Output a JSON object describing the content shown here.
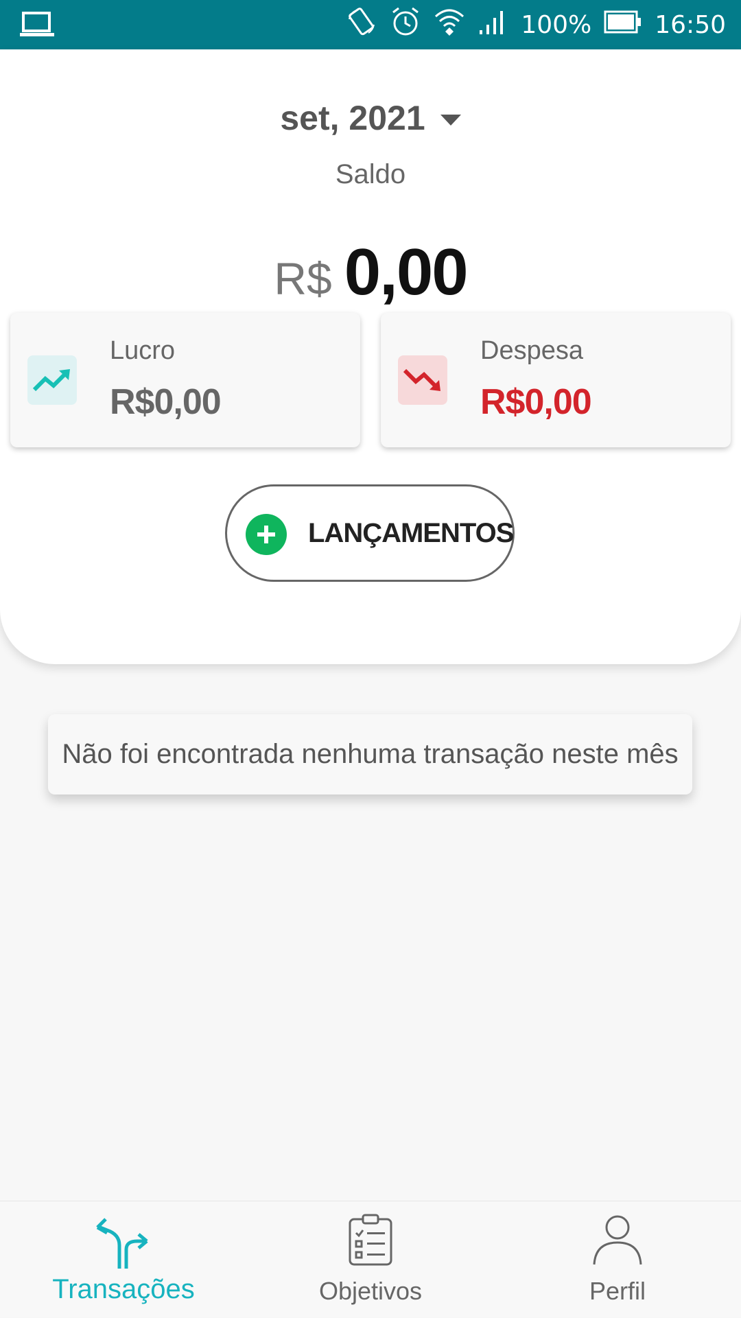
{
  "status_bar": {
    "battery": "100%",
    "time": "16:50",
    "icons": [
      "laptop-icon",
      "rotate-icon",
      "alarm-icon",
      "wifi-icon",
      "signal-icon",
      "battery-icon"
    ]
  },
  "header": {
    "month": "set, 2021",
    "balance_label": "Saldo",
    "currency": "R$",
    "balance_value": "0,00"
  },
  "summary": {
    "profit": {
      "label": "Lucro",
      "amount": "R$0,00",
      "icon": "trending-up-icon",
      "color": "#17c0b5"
    },
    "expense": {
      "label": "Despesa",
      "amount": "R$0,00",
      "icon": "trending-down-icon",
      "color": "#d3242b"
    }
  },
  "actions": {
    "lancamentos_label": "LANÇAMENTOS"
  },
  "transactions": {
    "empty_message": "Não foi encontrada nenhuma transação neste mês"
  },
  "bottom_nav": {
    "items": [
      {
        "label": "Transações",
        "icon": "transactions-icon",
        "active": true
      },
      {
        "label": "Objetivos",
        "icon": "clipboard-icon",
        "active": false
      },
      {
        "label": "Perfil",
        "icon": "user-icon",
        "active": false
      }
    ],
    "active_color": "#17b3bf"
  }
}
